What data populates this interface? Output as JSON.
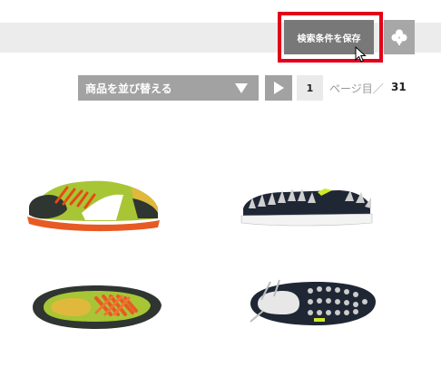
{
  "toolbar": {
    "save_search_label": "検索条件を保存",
    "clover_icon": "clover-icon"
  },
  "sort": {
    "label": "商品を並び替える",
    "arrow_icon": "triangle-down-icon"
  },
  "pagination": {
    "next_icon": "triangle-right-icon",
    "current_page": "1",
    "page_label": "ページ目／",
    "total_pages": "31"
  },
  "colors": {
    "highlight": "#e2001a",
    "button_dark": "#787878",
    "button_mid": "#a2a2a2",
    "bar_bg": "#ececec"
  },
  "products": [
    {
      "name": "green-orange-sneaker"
    },
    {
      "name": "black-studded-slip-on"
    },
    {
      "name": "green-orange-sneaker-top-view"
    },
    {
      "name": "dsquared-studded-slip-on-top-view"
    }
  ]
}
